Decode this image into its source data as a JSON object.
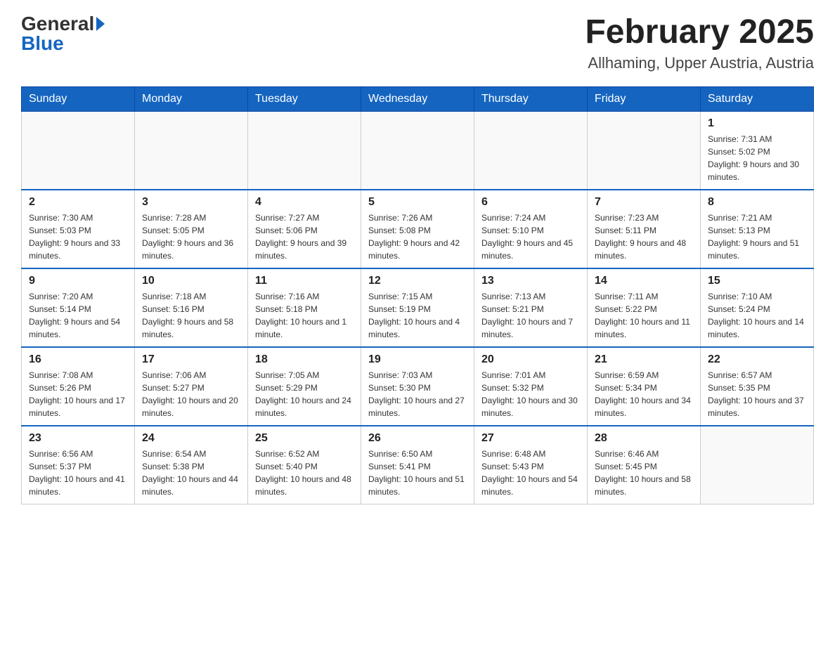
{
  "header": {
    "logo_general": "General",
    "logo_blue": "Blue",
    "title": "February 2025",
    "subtitle": "Allhaming, Upper Austria, Austria"
  },
  "days_of_week": [
    "Sunday",
    "Monday",
    "Tuesday",
    "Wednesday",
    "Thursday",
    "Friday",
    "Saturday"
  ],
  "weeks": [
    [
      {
        "day": "",
        "sunrise": "",
        "sunset": "",
        "daylight": ""
      },
      {
        "day": "",
        "sunrise": "",
        "sunset": "",
        "daylight": ""
      },
      {
        "day": "",
        "sunrise": "",
        "sunset": "",
        "daylight": ""
      },
      {
        "day": "",
        "sunrise": "",
        "sunset": "",
        "daylight": ""
      },
      {
        "day": "",
        "sunrise": "",
        "sunset": "",
        "daylight": ""
      },
      {
        "day": "",
        "sunrise": "",
        "sunset": "",
        "daylight": ""
      },
      {
        "day": "1",
        "sunrise": "Sunrise: 7:31 AM",
        "sunset": "Sunset: 5:02 PM",
        "daylight": "Daylight: 9 hours and 30 minutes."
      }
    ],
    [
      {
        "day": "2",
        "sunrise": "Sunrise: 7:30 AM",
        "sunset": "Sunset: 5:03 PM",
        "daylight": "Daylight: 9 hours and 33 minutes."
      },
      {
        "day": "3",
        "sunrise": "Sunrise: 7:28 AM",
        "sunset": "Sunset: 5:05 PM",
        "daylight": "Daylight: 9 hours and 36 minutes."
      },
      {
        "day": "4",
        "sunrise": "Sunrise: 7:27 AM",
        "sunset": "Sunset: 5:06 PM",
        "daylight": "Daylight: 9 hours and 39 minutes."
      },
      {
        "day": "5",
        "sunrise": "Sunrise: 7:26 AM",
        "sunset": "Sunset: 5:08 PM",
        "daylight": "Daylight: 9 hours and 42 minutes."
      },
      {
        "day": "6",
        "sunrise": "Sunrise: 7:24 AM",
        "sunset": "Sunset: 5:10 PM",
        "daylight": "Daylight: 9 hours and 45 minutes."
      },
      {
        "day": "7",
        "sunrise": "Sunrise: 7:23 AM",
        "sunset": "Sunset: 5:11 PM",
        "daylight": "Daylight: 9 hours and 48 minutes."
      },
      {
        "day": "8",
        "sunrise": "Sunrise: 7:21 AM",
        "sunset": "Sunset: 5:13 PM",
        "daylight": "Daylight: 9 hours and 51 minutes."
      }
    ],
    [
      {
        "day": "9",
        "sunrise": "Sunrise: 7:20 AM",
        "sunset": "Sunset: 5:14 PM",
        "daylight": "Daylight: 9 hours and 54 minutes."
      },
      {
        "day": "10",
        "sunrise": "Sunrise: 7:18 AM",
        "sunset": "Sunset: 5:16 PM",
        "daylight": "Daylight: 9 hours and 58 minutes."
      },
      {
        "day": "11",
        "sunrise": "Sunrise: 7:16 AM",
        "sunset": "Sunset: 5:18 PM",
        "daylight": "Daylight: 10 hours and 1 minute."
      },
      {
        "day": "12",
        "sunrise": "Sunrise: 7:15 AM",
        "sunset": "Sunset: 5:19 PM",
        "daylight": "Daylight: 10 hours and 4 minutes."
      },
      {
        "day": "13",
        "sunrise": "Sunrise: 7:13 AM",
        "sunset": "Sunset: 5:21 PM",
        "daylight": "Daylight: 10 hours and 7 minutes."
      },
      {
        "day": "14",
        "sunrise": "Sunrise: 7:11 AM",
        "sunset": "Sunset: 5:22 PM",
        "daylight": "Daylight: 10 hours and 11 minutes."
      },
      {
        "day": "15",
        "sunrise": "Sunrise: 7:10 AM",
        "sunset": "Sunset: 5:24 PM",
        "daylight": "Daylight: 10 hours and 14 minutes."
      }
    ],
    [
      {
        "day": "16",
        "sunrise": "Sunrise: 7:08 AM",
        "sunset": "Sunset: 5:26 PM",
        "daylight": "Daylight: 10 hours and 17 minutes."
      },
      {
        "day": "17",
        "sunrise": "Sunrise: 7:06 AM",
        "sunset": "Sunset: 5:27 PM",
        "daylight": "Daylight: 10 hours and 20 minutes."
      },
      {
        "day": "18",
        "sunrise": "Sunrise: 7:05 AM",
        "sunset": "Sunset: 5:29 PM",
        "daylight": "Daylight: 10 hours and 24 minutes."
      },
      {
        "day": "19",
        "sunrise": "Sunrise: 7:03 AM",
        "sunset": "Sunset: 5:30 PM",
        "daylight": "Daylight: 10 hours and 27 minutes."
      },
      {
        "day": "20",
        "sunrise": "Sunrise: 7:01 AM",
        "sunset": "Sunset: 5:32 PM",
        "daylight": "Daylight: 10 hours and 30 minutes."
      },
      {
        "day": "21",
        "sunrise": "Sunrise: 6:59 AM",
        "sunset": "Sunset: 5:34 PM",
        "daylight": "Daylight: 10 hours and 34 minutes."
      },
      {
        "day": "22",
        "sunrise": "Sunrise: 6:57 AM",
        "sunset": "Sunset: 5:35 PM",
        "daylight": "Daylight: 10 hours and 37 minutes."
      }
    ],
    [
      {
        "day": "23",
        "sunrise": "Sunrise: 6:56 AM",
        "sunset": "Sunset: 5:37 PM",
        "daylight": "Daylight: 10 hours and 41 minutes."
      },
      {
        "day": "24",
        "sunrise": "Sunrise: 6:54 AM",
        "sunset": "Sunset: 5:38 PM",
        "daylight": "Daylight: 10 hours and 44 minutes."
      },
      {
        "day": "25",
        "sunrise": "Sunrise: 6:52 AM",
        "sunset": "Sunset: 5:40 PM",
        "daylight": "Daylight: 10 hours and 48 minutes."
      },
      {
        "day": "26",
        "sunrise": "Sunrise: 6:50 AM",
        "sunset": "Sunset: 5:41 PM",
        "daylight": "Daylight: 10 hours and 51 minutes."
      },
      {
        "day": "27",
        "sunrise": "Sunrise: 6:48 AM",
        "sunset": "Sunset: 5:43 PM",
        "daylight": "Daylight: 10 hours and 54 minutes."
      },
      {
        "day": "28",
        "sunrise": "Sunrise: 6:46 AM",
        "sunset": "Sunset: 5:45 PM",
        "daylight": "Daylight: 10 hours and 58 minutes."
      },
      {
        "day": "",
        "sunrise": "",
        "sunset": "",
        "daylight": ""
      }
    ]
  ]
}
